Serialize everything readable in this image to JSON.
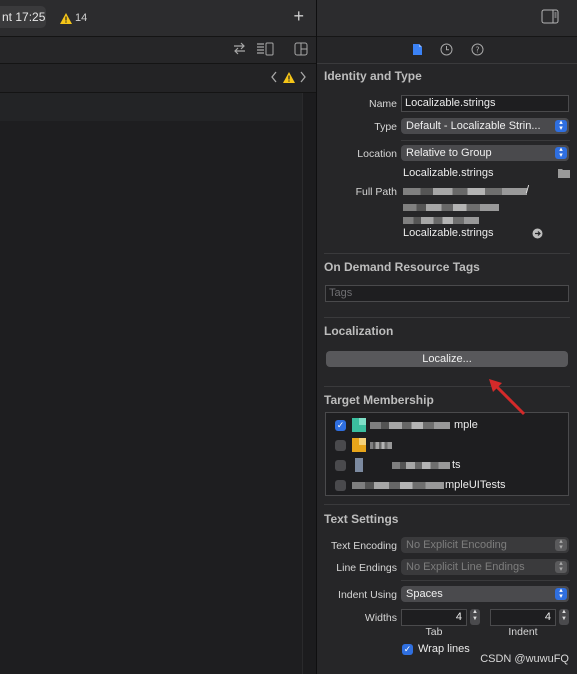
{
  "titlebar": {
    "clock": "nt 17:25",
    "warning_count": "14"
  },
  "inspector": {
    "identity": {
      "title": "Identity and Type",
      "name_label": "Name",
      "name_value": "Localizable.strings",
      "type_label": "Type",
      "type_value": "Default - Localizable Strin...",
      "location_label": "Location",
      "location_value": "Relative to Group",
      "location_file": "Localizable.strings",
      "fullpath_label": "Full Path",
      "fullpath_tail": "/",
      "fullpath_file": "Localizable.strings"
    },
    "odr": {
      "title": "On Demand Resource Tags",
      "tags_placeholder": "Tags"
    },
    "localization": {
      "title": "Localization",
      "button": "Localize..."
    },
    "membership": {
      "title": "Target Membership",
      "targets": [
        {
          "label": "mple",
          "checked": true
        },
        {
          "label": "",
          "checked": false
        },
        {
          "label": "ts",
          "checked": false
        },
        {
          "label": "mpleUITests",
          "checked": false
        }
      ]
    },
    "text_settings": {
      "title": "Text Settings",
      "encoding_label": "Text Encoding",
      "encoding_value": "No Explicit Encoding",
      "endings_label": "Line Endings",
      "endings_value": "No Explicit Line Endings",
      "indent_label": "Indent Using",
      "indent_value": "Spaces",
      "widths_label": "Widths",
      "tab_value": "4",
      "indent_width_value": "4",
      "tab_caption": "Tab",
      "indent_caption": "Indent",
      "wrap_label": "Wrap lines"
    }
  },
  "watermark": "CSDN @wuwuFQ",
  "colors": {
    "accent": "#2f6fe0",
    "arrow": "#d42a2a",
    "warning": "#f5c518"
  }
}
